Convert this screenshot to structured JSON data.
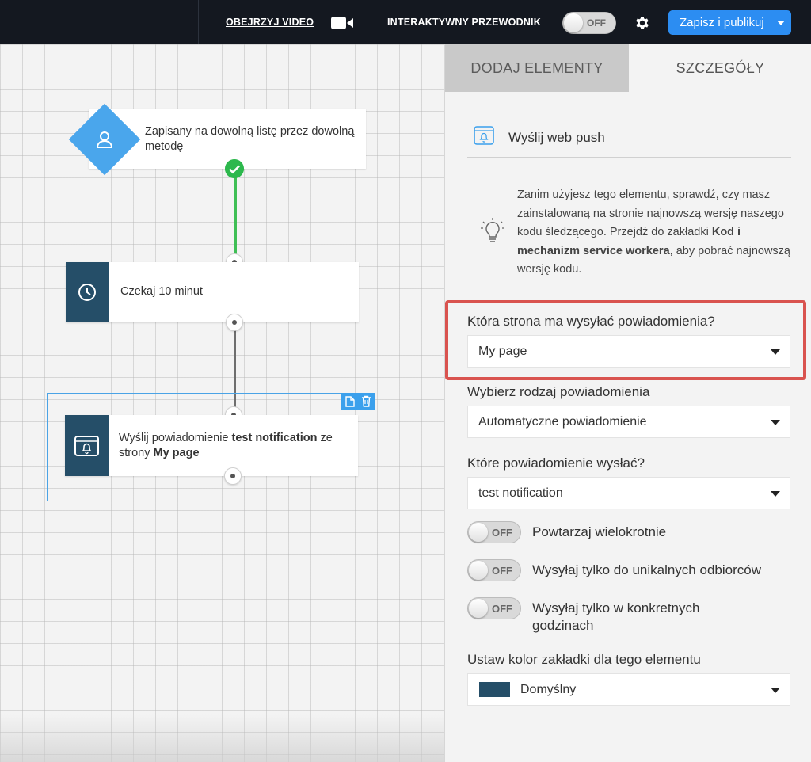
{
  "topbar": {
    "watch_video": "OBEJRZYJ VIDEO",
    "interactive_guide": "INTERAKTYWNY PRZEWODNIK",
    "guide_toggle": "OFF",
    "publish_button": "Zapisz i publikuj"
  },
  "canvas": {
    "nodes": [
      {
        "text": "Zapisany na dowolną listę przez dowolną metodę"
      },
      {
        "text": "Czekaj 10 minut"
      },
      {
        "text_prefix": "Wyślij powiadomienie ",
        "notification": "test notification",
        "text_mid": " ze strony ",
        "page": "My page"
      }
    ]
  },
  "panel": {
    "tabs": [
      "DODAJ ELEMENTY",
      "SZCZEGÓŁY"
    ],
    "title": "Wyślij web push",
    "info_part1": "Zanim użyjesz tego elementu, sprawdź, czy masz zainstalowaną na stronie najnowszą wersję naszego kodu śledzącego. Przejdź do zakładki ",
    "info_bold": "Kod i mechanizm service workera",
    "info_part2": ", aby pobrać najnowszą wersję kodu.",
    "fields": [
      {
        "label": "Która strona ma wysyłać powiadomienia?",
        "value": "My page"
      },
      {
        "label": "Wybierz rodzaj powiadomienia",
        "value": "Automatyczne powiadomienie"
      },
      {
        "label": "Które powiadomienie wysłać?",
        "value": "test notification"
      }
    ],
    "toggles": [
      {
        "state": "OFF",
        "label": "Powtarzaj wielokrotnie"
      },
      {
        "state": "OFF",
        "label": "Wysyłaj tylko do unikalnych odbiorców"
      },
      {
        "state": "OFF",
        "label": "Wysyłaj tylko w konkretnych godzinach"
      }
    ],
    "color_field": {
      "label": "Ustaw kolor zakładki dla tego elementu",
      "value": "Domyślny",
      "swatch": "#254e68"
    }
  },
  "colors": {
    "accent": "#2c8df2",
    "highlight": "#d9534f",
    "node_side": "#254e68",
    "trigger": "#4aa6ec",
    "connector_ok": "#3fbf55"
  }
}
